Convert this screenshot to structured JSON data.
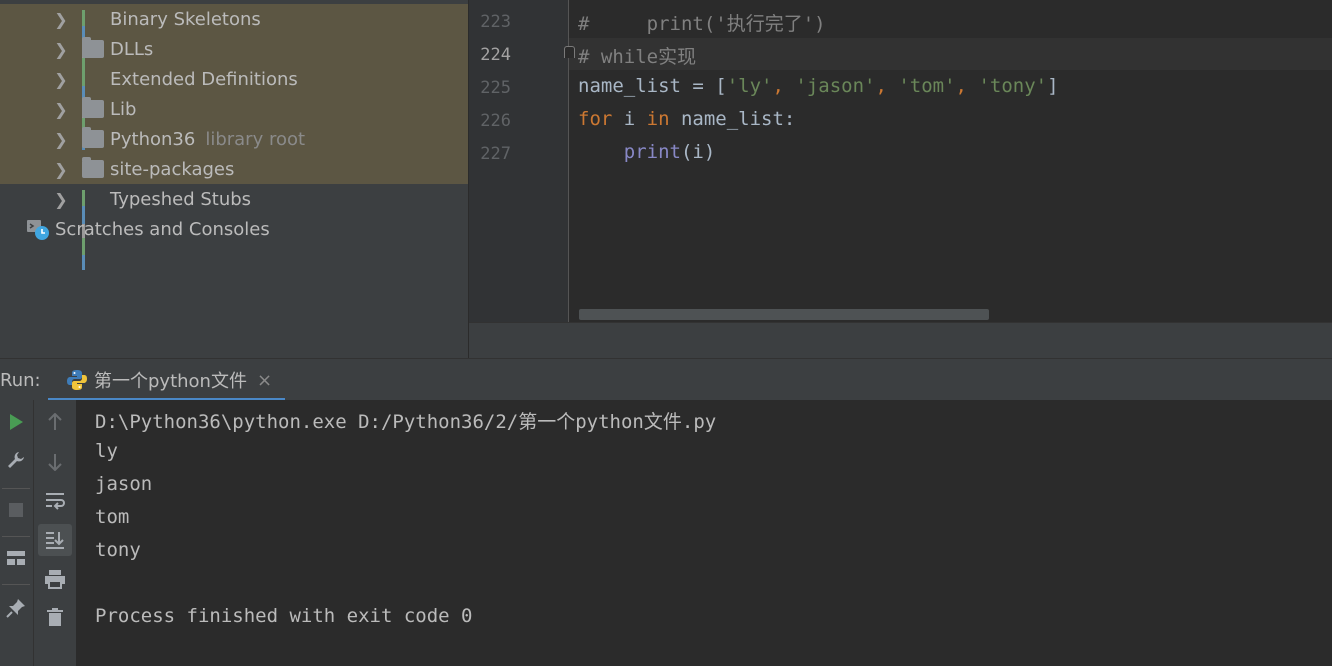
{
  "project_tree": {
    "items": [
      {
        "label": "Binary Skeletons",
        "icon": "library-bars-icon"
      },
      {
        "label": "DLLs",
        "icon": "folder-icon"
      },
      {
        "label": "Extended Definitions",
        "icon": "library-bars-icon"
      },
      {
        "label": "Lib",
        "icon": "folder-icon"
      },
      {
        "label": "Python36",
        "sub": "library root",
        "icon": "folder-icon"
      },
      {
        "label": "site-packages",
        "icon": "folder-icon"
      },
      {
        "label": "Typeshed Stubs",
        "icon": "library-bars-icon"
      }
    ],
    "scratches": {
      "label": "Scratches and Consoles",
      "icon": "scratches-icon"
    }
  },
  "editor": {
    "line_numbers": [
      "223",
      "224",
      "225",
      "226",
      "227"
    ],
    "current_line": "224",
    "code": {
      "l223": {
        "hash": "#",
        "text": "     print('执行完了')"
      },
      "l224": {
        "text": "# while实现"
      },
      "l225": {
        "var": "name_list = [",
        "s1": "'ly'",
        "c1": ", ",
        "s2": "'jason'",
        "c2": ", ",
        "s3": "'tom'",
        "c3": ", ",
        "s4": "'tony'",
        "end": "]"
      },
      "l226": {
        "kw1": "for",
        "mid1": " i ",
        "kw2": "in",
        "mid2": " name_list:"
      },
      "l227": {
        "indent": "    ",
        "fn": "print",
        "args": "(i)"
      }
    }
  },
  "run": {
    "label": "Run:",
    "tab_label": "第一个python文件",
    "tab_close": "×",
    "console_lines": [
      "D:\\Python36\\python.exe D:/Python36/2/第一个python文件.py",
      "ly",
      "jason",
      "tom",
      "tony",
      "",
      "Process finished with exit code 0"
    ]
  },
  "colors": {
    "tree_highlight": "#5c5643",
    "keyword": "#cc7832",
    "string": "#6a8759",
    "builtin": "#8888c6",
    "comment": "#808080",
    "run_green": "#499c54",
    "tab_underline": "#4a88c7"
  }
}
